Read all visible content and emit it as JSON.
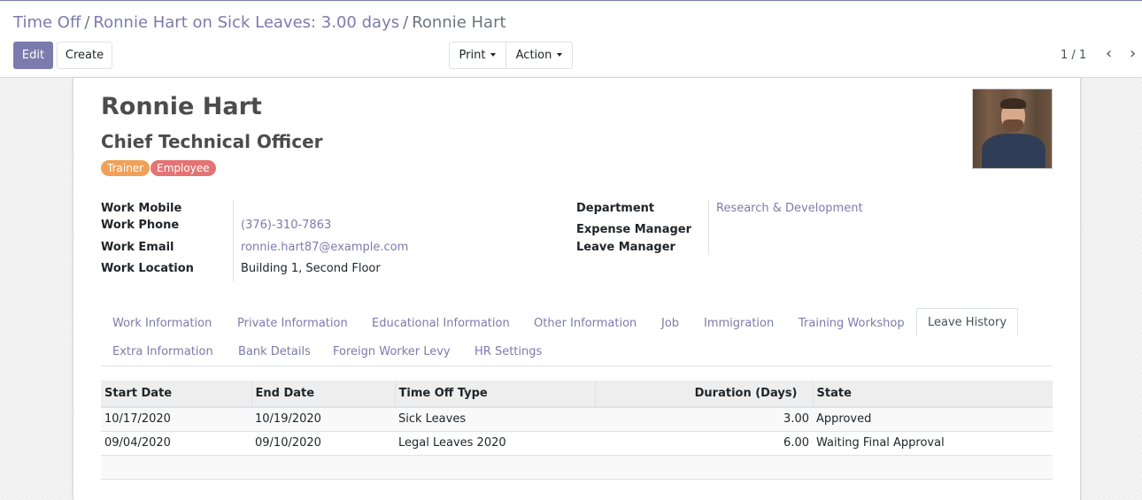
{
  "breadcrumb": {
    "root": "Time Off",
    "parent": "Ronnie Hart on Sick Leaves: 3.00 days",
    "current": "Ronnie Hart",
    "separator": "/"
  },
  "toolbar": {
    "edit_label": "Edit",
    "create_label": "Create",
    "print_label": "Print",
    "action_label": "Action"
  },
  "pager": {
    "value": "1 / 1"
  },
  "employee": {
    "name": "Ronnie Hart",
    "job_title": "Chief Technical Officer",
    "tags": [
      {
        "label": "Trainer",
        "color": "#f0a159"
      },
      {
        "label": "Employee",
        "color": "#e47373"
      }
    ]
  },
  "fields_left": {
    "work_mobile_label": "Work Mobile",
    "work_mobile_value": "",
    "work_phone_label": "Work Phone",
    "work_phone_value": "(376)-310-7863",
    "work_email_label": "Work Email",
    "work_email_value": "ronnie.hart87@example.com",
    "work_location_label": "Work Location",
    "work_location_value": "Building 1, Second Floor"
  },
  "fields_right": {
    "department_label": "Department",
    "department_value": "Research & Development",
    "expense_manager_label": "Expense Manager",
    "leave_manager_label": "Leave Manager"
  },
  "tabs": [
    {
      "label": "Work Information"
    },
    {
      "label": "Private Information"
    },
    {
      "label": "Educational Information"
    },
    {
      "label": "Other Information"
    },
    {
      "label": "Job"
    },
    {
      "label": "Immigration"
    },
    {
      "label": "Training Workshop"
    },
    {
      "label": "Leave History",
      "active": true
    },
    {
      "label": "Extra Information"
    },
    {
      "label": "Bank Details"
    },
    {
      "label": "Foreign Worker Levy"
    },
    {
      "label": "HR Settings"
    }
  ],
  "leave_table": {
    "headers": [
      "Start Date",
      "End Date",
      "Time Off Type",
      "Duration (Days)",
      "State"
    ],
    "rows": [
      [
        "10/17/2020",
        "10/19/2020",
        "Sick Leaves",
        "3.00",
        "Approved"
      ],
      [
        "09/04/2020",
        "09/10/2020",
        "Legal Leaves 2020",
        "6.00",
        "Waiting Final Approval"
      ]
    ]
  },
  "colors": {
    "brand": "#7c7bad",
    "tag_trainer": "#f0a159",
    "tag_employee": "#e47373"
  }
}
